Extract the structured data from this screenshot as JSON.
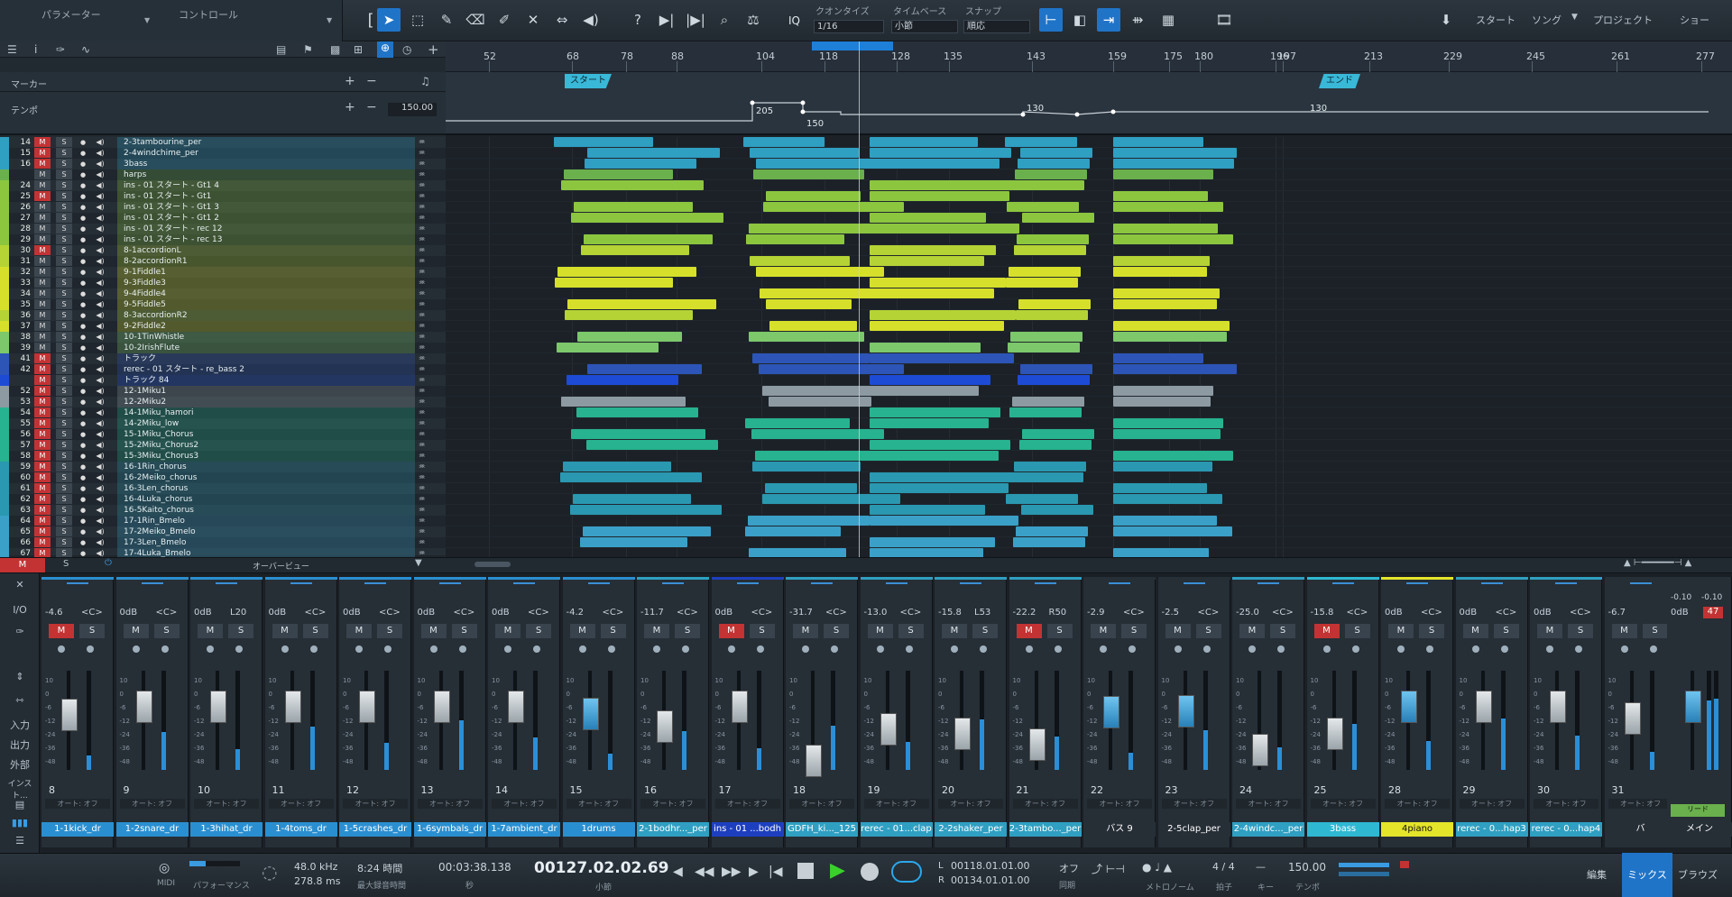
{
  "toolbar": {
    "parameter_label": "パラメーター",
    "control_label": "コントロール",
    "quantize_label": "クオンタイズ",
    "quantize_value": "1/16",
    "timebase_label": "タイムベース",
    "timebase_value": "小節",
    "snap_label": "スナップ",
    "snap_value": "順応",
    "iq_label": "IQ",
    "start_tab": "スタート",
    "song_tab": "ソング",
    "project_tab": "プロジェクト",
    "show_tab": "ショー"
  },
  "header": {
    "marker_label": "マーカー",
    "tempo_label": "テンポ",
    "tempo_value": "150.00"
  },
  "ruler": {
    "labels": [
      "52",
      "68",
      "78",
      "88",
      "104",
      "118",
      "128",
      "135",
      "143",
      "159",
      "175",
      "180",
      "196",
      "197",
      "213",
      "229",
      "245",
      "261",
      "277"
    ]
  },
  "markers": {
    "start": "スタート",
    "end": "エンド"
  },
  "tempo_points": [
    "205",
    "150",
    "130",
    "130"
  ],
  "tracks": [
    {
      "num": "14",
      "m": true,
      "name": "2-3tambourine_per",
      "color": "#2f9fc2"
    },
    {
      "num": "15",
      "m": true,
      "name": "2-4windchime_per",
      "color": "#2f9fc2"
    },
    {
      "num": "16",
      "m": true,
      "name": "3bass",
      "color": "#2f9fc2"
    },
    {
      "num": "",
      "m": false,
      "name": "harps",
      "color": "#6ab04c"
    },
    {
      "num": "24",
      "m": false,
      "name": "ins - 01 スタート - Gt1 4",
      "color": "#8cc63f"
    },
    {
      "num": "25",
      "m": true,
      "name": "ins - 01 スタート - Gt1",
      "color": "#8cc63f"
    },
    {
      "num": "26",
      "m": false,
      "name": "ins - 01 スタート - Gt1 3",
      "color": "#8cc63f"
    },
    {
      "num": "27",
      "m": false,
      "name": "ins - 01 スタート - Gt1 2",
      "color": "#8cc63f"
    },
    {
      "num": "28",
      "m": false,
      "name": "ins - 01 スタート - rec 12",
      "color": "#8cc63f"
    },
    {
      "num": "29",
      "m": false,
      "name": "ins - 01 スタート - rec 13",
      "color": "#8cc63f"
    },
    {
      "num": "30",
      "m": true,
      "name": "8-1accordionL",
      "color": "#b5d334"
    },
    {
      "num": "31",
      "m": false,
      "name": "8-2accordionR1",
      "color": "#b5d334"
    },
    {
      "num": "32",
      "m": false,
      "name": "9-1Fiddle1",
      "color": "#d6e02a"
    },
    {
      "num": "33",
      "m": false,
      "name": "9-3Fiddle3",
      "color": "#d6e02a"
    },
    {
      "num": "34",
      "m": false,
      "name": "9-4Fiddle4",
      "color": "#d6e02a"
    },
    {
      "num": "35",
      "m": false,
      "name": "9-5Fiddle5",
      "color": "#d6e02a"
    },
    {
      "num": "36",
      "m": false,
      "name": "8-3accordionR2",
      "color": "#b5d334"
    },
    {
      "num": "37",
      "m": false,
      "name": "9-2Fiddle2",
      "color": "#d6e02a"
    },
    {
      "num": "38",
      "m": false,
      "name": "10-1TinWhistle",
      "color": "#7cc86b"
    },
    {
      "num": "39",
      "m": false,
      "name": "10-2IrishFlute",
      "color": "#7cc86b"
    },
    {
      "num": "41",
      "m": true,
      "name": "トラック",
      "color": "#2d55b8"
    },
    {
      "num": "42",
      "m": true,
      "name": "rerec - 01 スタート - re_bass 2",
      "color": "#2d55b8"
    },
    {
      "num": "",
      "m": true,
      "name": "トラック 84",
      "color": "#1e4bd6"
    },
    {
      "num": "52",
      "m": true,
      "name": "12-1Miku1",
      "color": "#8d9aa2"
    },
    {
      "num": "53",
      "m": true,
      "name": "12-2Miku2",
      "color": "#8d9aa2"
    },
    {
      "num": "54",
      "m": true,
      "name": "14-1Miku_hamori",
      "color": "#27b38f"
    },
    {
      "num": "55",
      "m": true,
      "name": "14-2Miku_low",
      "color": "#27b38f"
    },
    {
      "num": "56",
      "m": true,
      "name": "15-1Miku_Chorus",
      "color": "#27b38f"
    },
    {
      "num": "57",
      "m": true,
      "name": "15-2Miku_Chorus2",
      "color": "#27b38f"
    },
    {
      "num": "58",
      "m": true,
      "name": "15-3Miku_Chorus3",
      "color": "#27b38f"
    },
    {
      "num": "59",
      "m": true,
      "name": "16-1Rin_chorus",
      "color": "#2a98b0"
    },
    {
      "num": "60",
      "m": true,
      "name": "16-2Meiko_chorus",
      "color": "#2a98b0"
    },
    {
      "num": "61",
      "m": true,
      "name": "16-3Len_chorus",
      "color": "#2a98b0"
    },
    {
      "num": "62",
      "m": true,
      "name": "16-4Luka_chorus",
      "color": "#2a98b0"
    },
    {
      "num": "63",
      "m": true,
      "name": "16-5Kaito_chorus",
      "color": "#2a98b0"
    },
    {
      "num": "64",
      "m": true,
      "name": "17-1Rin_Bmelo",
      "color": "#3aa0c8"
    },
    {
      "num": "65",
      "m": true,
      "name": "17-2Meiko_Bmelo",
      "color": "#3aa0c8"
    },
    {
      "num": "66",
      "m": true,
      "name": "17-3Len_Bmelo",
      "color": "#3aa0c8"
    },
    {
      "num": "67",
      "m": true,
      "name": "17-4Luka_Bmelo",
      "color": "#3aa0c8"
    }
  ],
  "lower_bar": {
    "m": "M",
    "s": "S",
    "overview": "オーバービュー"
  },
  "mixer_left": {
    "io": "I/O",
    "input": "入力",
    "output": "出力",
    "external": "外部",
    "instrument": "インスト..."
  },
  "strips": [
    {
      "num": "8",
      "vol": "-4.6",
      "pan": "<C>",
      "name": "1-1kick_dr",
      "color": "#2a8fd0",
      "mute": true
    },
    {
      "num": "9",
      "vol": "0dB",
      "pan": "<C>",
      "name": "1-2snare_dr",
      "color": "#2a8fd0",
      "mute": false
    },
    {
      "num": "10",
      "vol": "0dB",
      "pan": "L20",
      "name": "1-3hihat_dr",
      "color": "#2a8fd0",
      "mute": false
    },
    {
      "num": "11",
      "vol": "0dB",
      "pan": "<C>",
      "name": "1-4toms_dr",
      "color": "#2a8fd0",
      "mute": false
    },
    {
      "num": "12",
      "vol": "0dB",
      "pan": "<C>",
      "name": "1-5crashes_dr",
      "color": "#2a8fd0",
      "mute": false
    },
    {
      "num": "13",
      "vol": "0dB",
      "pan": "<C>",
      "name": "1-6symbals_dr",
      "color": "#2a8fd0",
      "mute": false
    },
    {
      "num": "14",
      "vol": "0dB",
      "pan": "<C>",
      "name": "1-7ambient_dr",
      "color": "#2a8fd0",
      "mute": false
    },
    {
      "num": "15",
      "vol": "-4.2",
      "pan": "<C>",
      "name": "1drums",
      "color": "#2a8fd0",
      "mute": false
    },
    {
      "num": "16",
      "vol": "-11.7",
      "pan": "<C>",
      "name": "2-1bodhr..._per",
      "color": "#2f9fc2",
      "mute": false
    },
    {
      "num": "17",
      "vol": "0dB",
      "pan": "<C>",
      "name": "ins - 01 ...bodh",
      "color": "#1d3fbf",
      "mute": true
    },
    {
      "num": "18",
      "vol": "-31.7",
      "pan": "<C>",
      "name": "GDFH_ki..._125",
      "color": "#2f9fc2",
      "mute": false
    },
    {
      "num": "19",
      "vol": "-13.0",
      "pan": "<C>",
      "name": "rerec - 01...clap",
      "color": "#2f9fc2",
      "mute": false
    },
    {
      "num": "20",
      "vol": "-15.8",
      "pan": "L53",
      "name": "2-2shaker_per",
      "color": "#2f9fc2",
      "mute": false
    },
    {
      "num": "21",
      "vol": "-22.2",
      "pan": "R50",
      "name": "2-3tambo..._per",
      "color": "#2f9fc2",
      "mute": true
    },
    {
      "num": "22",
      "vol": "-2.9",
      "pan": "<C>",
      "name": "バス 9",
      "color": "#262e36",
      "mute": false
    },
    {
      "num": "23",
      "vol": "-2.5",
      "pan": "<C>",
      "name": "2-5clap_per",
      "color": "#262e36",
      "mute": false
    },
    {
      "num": "24",
      "vol": "-25.0",
      "pan": "<C>",
      "name": "2-4windc..._per",
      "color": "#2f9fc2",
      "mute": false
    },
    {
      "num": "25",
      "vol": "-15.8",
      "pan": "<C>",
      "name": "3bass",
      "color": "#2fb8d2",
      "mute": true
    },
    {
      "num": "28",
      "vol": "0dB",
      "pan": "<C>",
      "name": "4piano",
      "color": "#e4e42a",
      "mute": false
    },
    {
      "num": "29",
      "vol": "0dB",
      "pan": "<C>",
      "name": "rerec - 0...hap3",
      "color": "#2f9fc2",
      "mute": false
    },
    {
      "num": "30",
      "vol": "0dB",
      "pan": "<C>",
      "name": "rerec - 0...hap4",
      "color": "#2f9fc2",
      "mute": false
    },
    {
      "num": "31",
      "vol": "-6.7",
      "pan": "",
      "name": "バ",
      "color": "#262e36",
      "mute": false
    }
  ],
  "main_strip": {
    "vol": "0dB",
    "peak": "-0.10",
    "peak2": "-0.10",
    "clip": "47",
    "name": "メイン",
    "read": "リード"
  },
  "transport": {
    "midi": "MIDI",
    "performance": "パフォーマンス",
    "sample_rate": "48.0 kHz",
    "latency": "278.8 ms",
    "rec_time": "8:24 時間",
    "rec_label": "最大録音時間",
    "seconds": "00:03:38.138",
    "seconds_label": "秒",
    "bars": "00127.02.02.69",
    "bars_label": "小節",
    "loop_l": "00118.01.01.00",
    "loop_r": "00134.01.01.00",
    "l": "L",
    "r": "R",
    "sync": "オフ",
    "sync_label": "同期",
    "metronome_label": "メトロノーム",
    "timesig": "4 / 4",
    "timesig_label": "拍子",
    "key_label": "キー",
    "tempo": "150.00",
    "tempo_label": "テンポ"
  },
  "view_tabs": {
    "edit": "編集",
    "mix": "ミックス",
    "browse": "ブラウズ"
  }
}
